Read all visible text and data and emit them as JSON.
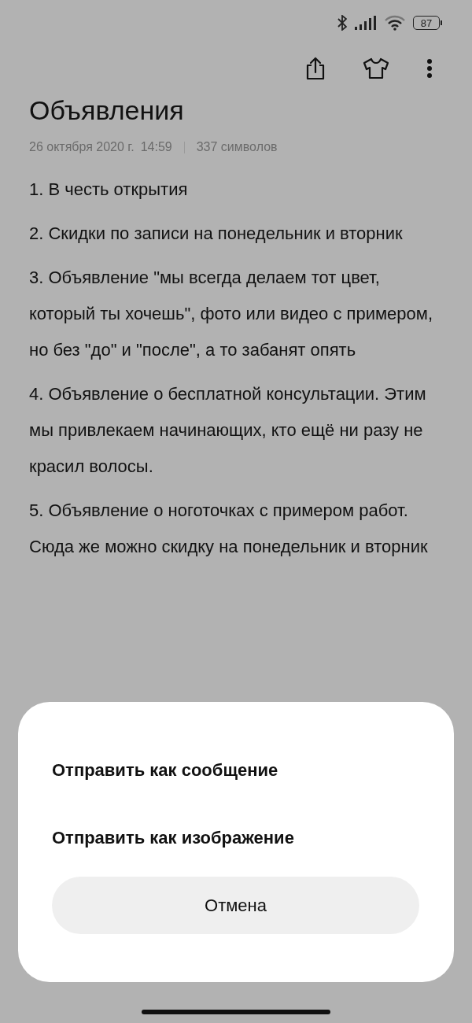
{
  "status_bar": {
    "battery": "87"
  },
  "note": {
    "title": "Объявления",
    "date": "26 октября 2020 г.",
    "time": "14:59",
    "char_count": "337 символов",
    "paragraphs": [
      "1. В честь открытия",
      "2. Скидки по записи на понедельник и вторник",
      "3. Объявление \"мы всегда делаем тот цвет, который ты хочешь\", фото или видео с примером, но без \"до\" и \"после\", а то забанят опять",
      "4. Объявление о бесплатной консультации. Этим мы привлекаем начинающих, кто ещё ни разу не красил волосы.",
      "5. Объявление о ноготочках с примером работ. Сюда же можно скидку на понедельник и вторник"
    ]
  },
  "share_sheet": {
    "options": [
      "Отправить как сообщение",
      "Отправить как изображение"
    ],
    "cancel": "Отмена"
  }
}
